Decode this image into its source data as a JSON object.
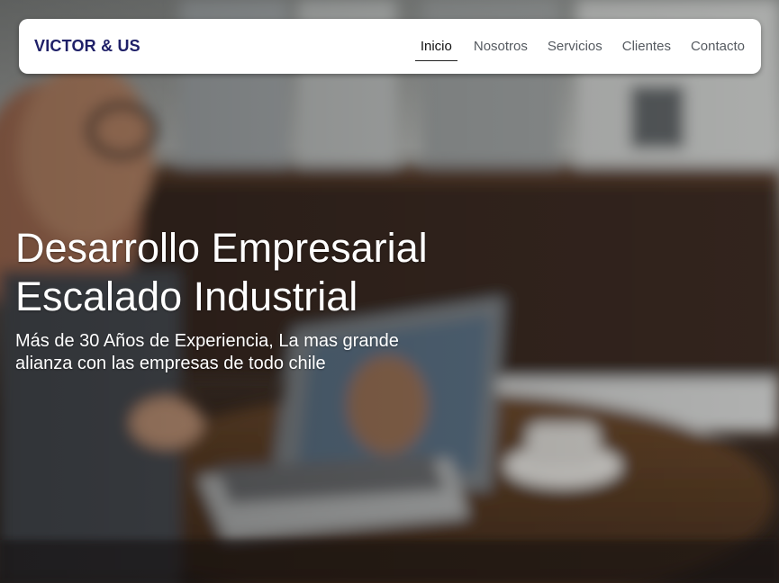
{
  "navbar": {
    "brand": "VICTOR & US",
    "links": [
      {
        "label": "Inicio",
        "active": true
      },
      {
        "label": "Nosotros",
        "active": false
      },
      {
        "label": "Servicios",
        "active": false
      },
      {
        "label": "Clientes",
        "active": false
      },
      {
        "label": "Contacto",
        "active": false
      }
    ]
  },
  "hero": {
    "title_line_1": "Desarrollo Empresarial",
    "title_line_2": "Escalado Industrial",
    "subtitle": "Más de 30 Años de Experiencia, La mas grande alianza con las empresas de todo chile"
  },
  "colors": {
    "brand": "#1f2068",
    "nav_text": "#555a60",
    "nav_active": "#111111",
    "hero_text": "#ffffff"
  }
}
